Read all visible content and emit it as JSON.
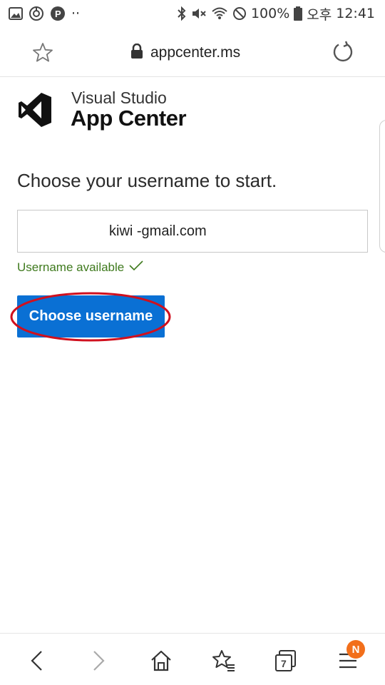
{
  "status_bar": {
    "battery": "100%",
    "ampm": "오후",
    "time": "12:41",
    "dots": "··"
  },
  "browser": {
    "url": "appcenter.ms",
    "tab_count": "7",
    "notification_badge": "N",
    "icons": [
      "star-icon",
      "lock-icon",
      "reload-icon",
      "back-icon",
      "forward-icon",
      "home-icon",
      "bookmarks-icon",
      "tabs-icon",
      "menu-icon"
    ]
  },
  "brand": {
    "line1": "Visual Studio",
    "line2": "App Center"
  },
  "form": {
    "heading": "Choose your username to start.",
    "username_value": "kiwi -gmail.com",
    "availability": "Username available",
    "button_label": "Choose username"
  },
  "colors": {
    "primary_button": "#0a70d4",
    "success_text": "#3f7a1e",
    "annotation_ellipse": "#d0101e",
    "badge": "#f26f1b"
  }
}
